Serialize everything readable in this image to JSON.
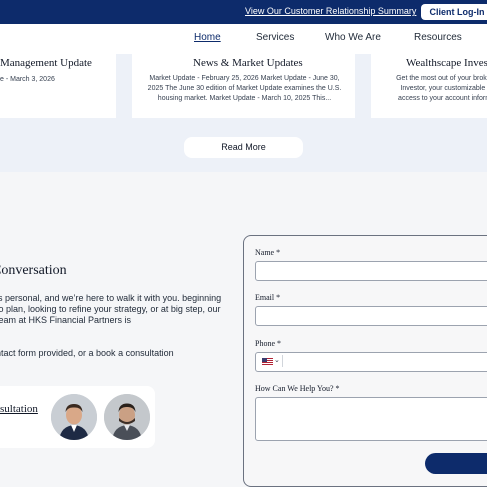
{
  "topbar": {
    "crs_link": "View Our Customer Relationship Summary",
    "login_button": "Client Log-In"
  },
  "nav": {
    "items": [
      "Home",
      "Services",
      "Who We Are",
      "Resources"
    ],
    "active": "Home"
  },
  "cards": [
    {
      "title": "Management Update",
      "body": "e - March 3, 2026"
    },
    {
      "title": "News & Market Updates",
      "body": "Market Update - February 25, 2026 Market Update - June 30, 2025  The June 30 edition of Market Update examines the U.S. housing market. Market Update - March 10, 2025   This..."
    },
    {
      "title": "Wealthscape Investo",
      "body": "Get the most out of your brokera\nInvestor, your customizable in\naccess to your account informa"
    }
  ],
  "read_more": "Read More",
  "contact": {
    "heading": "Conversation",
    "para1": "is personal, and we’re here to walk it with you. beginning to plan, looking to refine your strategy, or at big step, our team at HKS Financial Partners is",
    "para2": "ntact form provided, or a book a consultation",
    "consult_link": "sultation"
  },
  "form": {
    "name_label": "Name *",
    "email_label": "Email *",
    "phone_label": "Phone *",
    "help_label": "How Can We Help You? *",
    "country_flag": "us-flag-icon"
  },
  "colors": {
    "brand_navy": "#0d2b6b",
    "band_bg": "#edf1f8",
    "lower_bg": "#f5f6f8"
  }
}
